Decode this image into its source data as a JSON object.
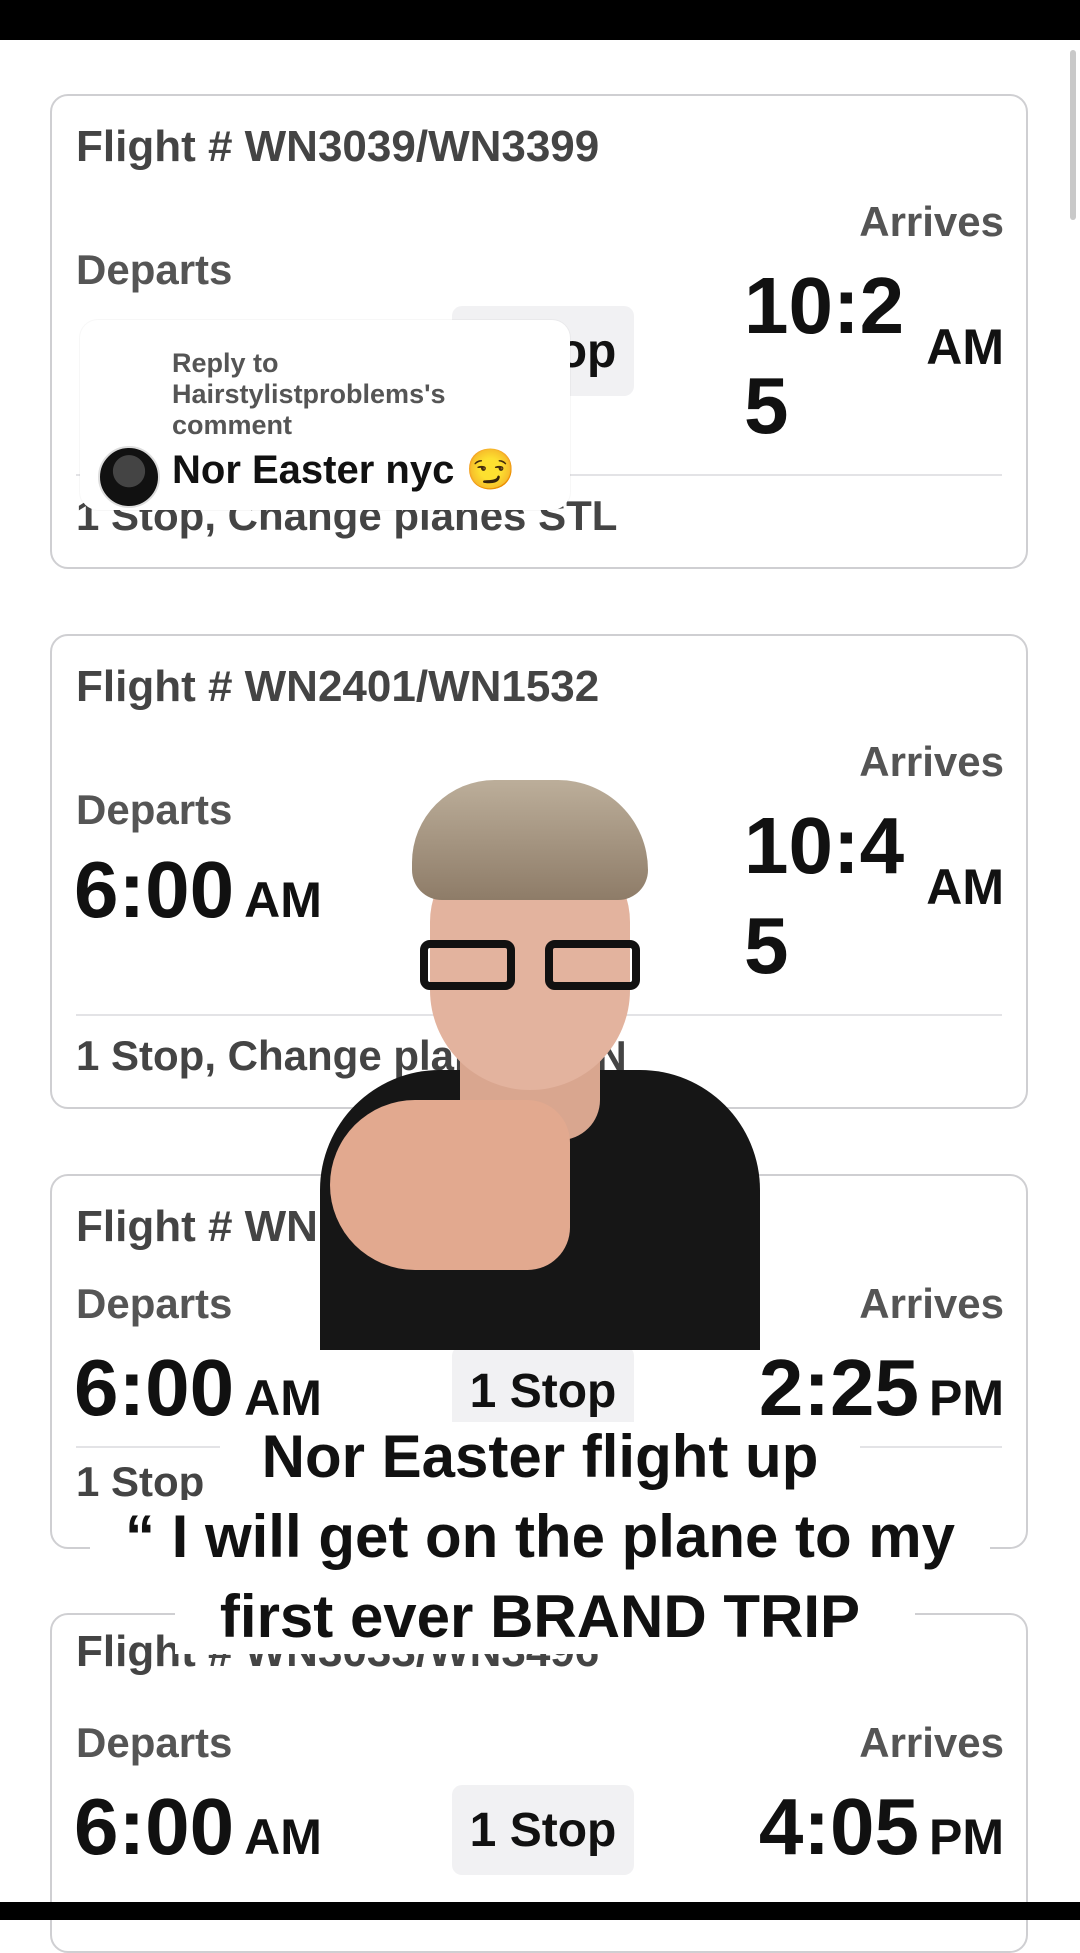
{
  "cards": [
    {
      "flight_number": "Flight # WN3039/WN3399",
      "departs_label": "Departs",
      "arrives_label": "Arrives",
      "stop_chip": "1 Stop",
      "arrive_time": "10:25",
      "arrive_ampm": "AM",
      "stops_info": "1 Stop, Change planes STL"
    },
    {
      "flight_number": "Flight # WN2401/WN1532",
      "departs_label": "Departs",
      "depart_time": "6:00",
      "depart_ampm": "AM",
      "arrives_label": "Arrives",
      "arrive_time": "10:45",
      "arrive_ampm": "AM",
      "stops_info": "1 Stop, Change planes DEN"
    },
    {
      "flight_number": "Flight # WN",
      "departs_label": "Departs",
      "depart_time": "6:00",
      "depart_ampm": "AM",
      "stop_chip": "1 Stop",
      "arrives_label": "Arrives",
      "arrive_time": "2:25",
      "arrive_ampm": "PM",
      "stops_info": "1 Stop"
    },
    {
      "flight_number": "Flight # WN3033/WN3496",
      "departs_label": "Departs",
      "depart_time": "6:00",
      "depart_ampm": "AM",
      "stop_chip": "1 Stop",
      "arrives_label": "Arrives",
      "arrive_time": "4:05",
      "arrive_ampm": "PM"
    }
  ],
  "reply": {
    "line1": "Reply to",
    "line2": "Hairstylistproblems's",
    "line3": "comment",
    "comment": "Nor Easter nyc 😏"
  },
  "caption": {
    "line1": "Nor Easter flight up",
    "line2": "“ I will get on the plane to my",
    "line3": "first ever BRAND TRIP"
  },
  "colors": {
    "text": "#111111",
    "label": "#555555",
    "border": "#cfcfd2",
    "chip": "#f1f1f3"
  }
}
